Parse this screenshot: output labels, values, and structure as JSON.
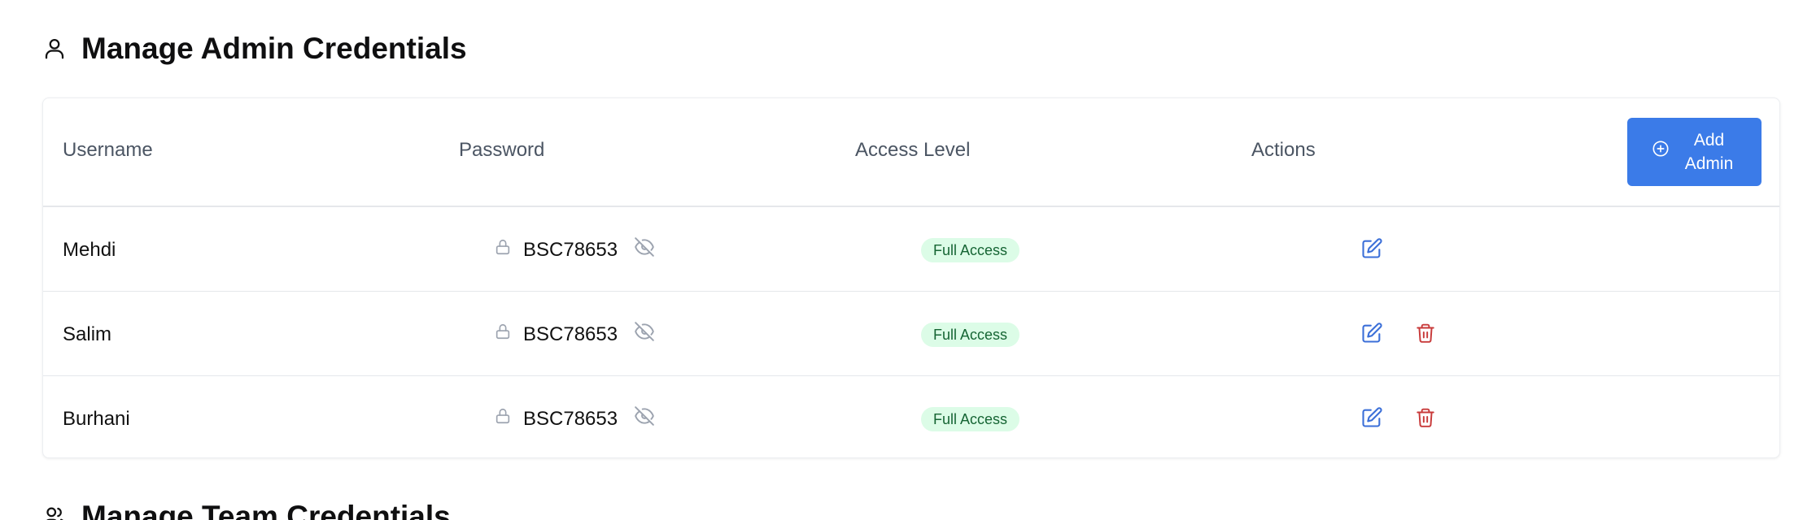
{
  "admin_section": {
    "title": "Manage Admin Credentials",
    "icon": "user-icon"
  },
  "table": {
    "headers": {
      "username": "Username",
      "password": "Password",
      "access_level": "Access Level",
      "actions": "Actions"
    },
    "add_button": {
      "label": "Add Admin",
      "icon": "plus-circle-icon"
    },
    "rows": [
      {
        "username": "Mehdi",
        "password": "BSC78653",
        "access_level": "Full Access",
        "deletable": false
      },
      {
        "username": "Salim",
        "password": "BSC78653",
        "access_level": "Full Access",
        "deletable": true
      },
      {
        "username": "Burhani",
        "password": "BSC78653",
        "access_level": "Full Access",
        "deletable": true
      }
    ]
  },
  "team_section": {
    "title": "Manage Team Credentials",
    "icon": "users-icon"
  },
  "colors": {
    "accent": "#3b7be8",
    "edit_icon": "#3b6fd8",
    "delete_icon": "#c83a3a",
    "badge_bg": "#dcfce7",
    "badge_text": "#166534"
  }
}
